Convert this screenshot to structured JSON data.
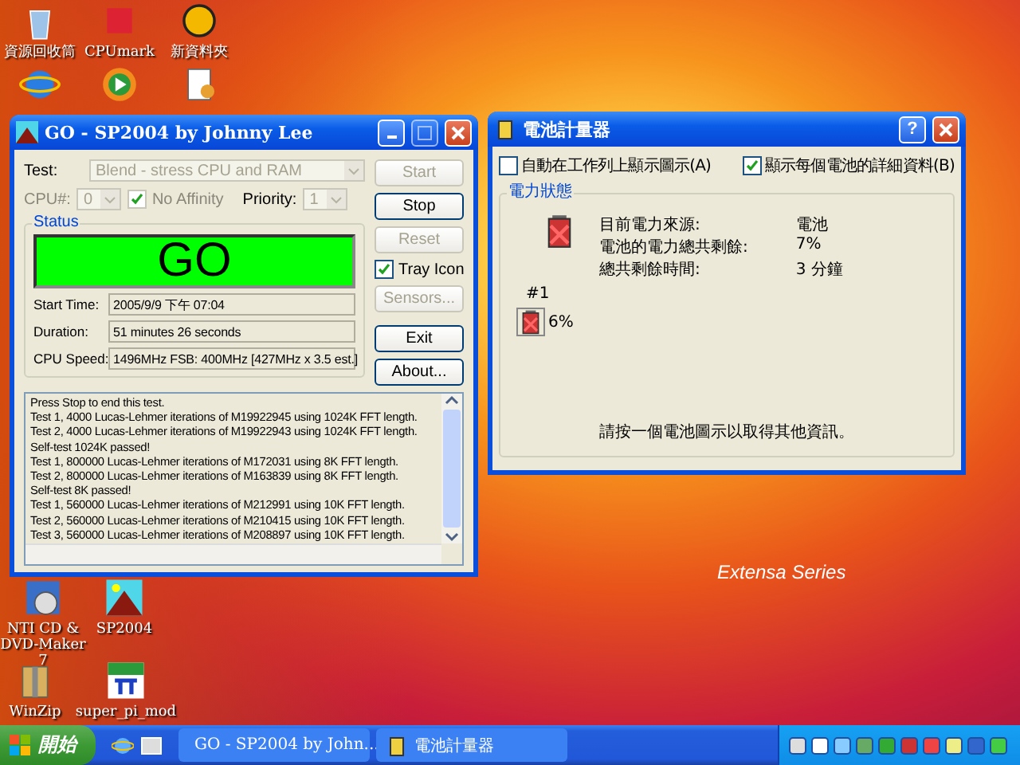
{
  "desktop_icons": [
    {
      "label": "資源回收筒",
      "kind": "recycle"
    },
    {
      "label": "CPUmark",
      "kind": "cpumark"
    },
    {
      "label": "新資料夾",
      "kind": "folder"
    },
    {
      "kind": "browser"
    },
    {
      "kind": "player"
    },
    {
      "kind": "document"
    },
    {
      "label": "NTI CD & DVD-Maker 7",
      "kind": "disc"
    },
    {
      "label": "SP2004",
      "kind": "mountain"
    },
    {
      "label": "WinZip",
      "kind": "zip"
    },
    {
      "label": "super_pi_mod",
      "kind": "superpi"
    }
  ],
  "wallpaper_text": "Extensa Series",
  "go_window": {
    "title": "GO - SP2004 by Johnny Lee",
    "test_label": "Test:",
    "test_value": "Blend - stress CPU and RAM",
    "cpu_label": "CPU#:",
    "cpu_value": "0",
    "no_affinity": {
      "label": "No Affinity",
      "checked": true,
      "disabled": true
    },
    "priority_label": "Priority:",
    "priority_value": "1",
    "status_label": "Status",
    "status_text": "GO",
    "fields": [
      {
        "label": "Start Time:",
        "value": "2005/9/9 下午 07:04"
      },
      {
        "label": "Duration:",
        "value": "51 minutes 26 seconds"
      },
      {
        "label": "CPU Speed:",
        "value": "1496MHz FSB: 400MHz [427MHz x 3.5 est.]"
      }
    ],
    "buttons": [
      {
        "label": "Start",
        "disabled": true
      },
      {
        "label": "Stop",
        "disabled": false
      },
      {
        "label": "Reset",
        "disabled": true
      },
      {
        "label": "Sensors...",
        "disabled": true
      },
      {
        "label": "Exit",
        "disabled": false
      },
      {
        "label": "About...",
        "disabled": false
      }
    ],
    "tray_icon": {
      "label": "Tray Icon",
      "checked": true
    },
    "log": [
      "Press Stop to end this test.",
      "Test 1, 4000 Lucas-Lehmer iterations of M19922945 using 1024K FFT length.",
      "Test 2, 4000 Lucas-Lehmer iterations of M19922943 using 1024K FFT length.",
      "Self-test 1024K passed!",
      "Test 1, 800000 Lucas-Lehmer iterations of M172031 using 8K FFT length.",
      "Test 2, 800000 Lucas-Lehmer iterations of M163839 using 8K FFT length.",
      "Self-test 8K passed!",
      "Test 1, 560000 Lucas-Lehmer iterations of M212991 using 10K FFT length.",
      "Test 2, 560000 Lucas-Lehmer iterations of M210415 using 10K FFT length.",
      "Test 3, 560000 Lucas-Lehmer iterations of M208897 using 10K FFT length."
    ]
  },
  "battery_window": {
    "title": "電池計量器",
    "help_button": "?",
    "checkboxes": [
      {
        "label": "自動在工作列上顯示圖示(A)",
        "checked": false
      },
      {
        "label": "顯示每個電池的詳細資料(B)",
        "checked": true
      }
    ],
    "group_label": "電力狀態",
    "info": [
      {
        "label": "目前電力來源:",
        "value": "電池"
      },
      {
        "label": "電池的電力總共剩餘:",
        "value": "7%"
      },
      {
        "label": "總共剩餘時間:",
        "value": "3 分鐘"
      }
    ],
    "battery": {
      "number": "#1",
      "percent": "6%"
    },
    "hint": "請按一個電池圖示以取得其他資訊。"
  },
  "taskbar": {
    "start": "開始",
    "tasks": [
      {
        "label": "GO - SP2004 by John...",
        "selected": false,
        "kind": "sp"
      },
      {
        "label": "電池計量器",
        "selected": false,
        "kind": "battery"
      }
    ]
  }
}
